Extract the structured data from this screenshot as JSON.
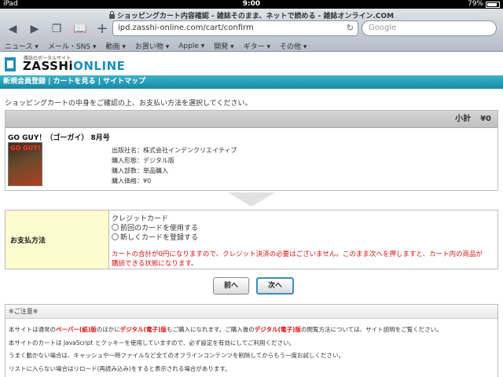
{
  "status": {
    "carrier": "iPad",
    "time": "9:00",
    "battery": "79%"
  },
  "browser": {
    "title": "ショッピングカート内容確認 - 雑誌そのまま、ネットで読める - 雑誌オンライン.COM",
    "url": "ipd.zasshi-online.com/cart/confirm",
    "search_placeholder": "Google",
    "bookmarks": [
      "ニュース ▾",
      "メール・SNS ▾",
      "動画 ▾",
      "お買い物 ▾",
      "Apple ▾",
      "開発 ▾",
      "ギター ▾",
      "その他 ▾"
    ],
    "icons": [
      "back-icon",
      "forward-icon",
      "tabs-icon",
      "bookmarks-icon",
      "add-icon",
      "reload-icon",
      "lock-icon"
    ]
  },
  "site": {
    "logo_sub": "雑誌のポータルサイト",
    "logo_prefix": "ZASSHi",
    "logo_accent": "ONLINE",
    "nav": "新規会員登録 | カートを見る | サイトマップ",
    "brand_color": "#1a8fb8"
  },
  "cart": {
    "intro": "ショッピングカートの中身をご確認の上、お支払い方法を選択してください。",
    "subtotal_label": "小計",
    "subtotal_value": "¥0",
    "item": {
      "title": "GO GUY！（ゴーガイ） 8月号",
      "cover_text": "GO GUY!",
      "details": [
        "出版社名：株式会社インデンクリエイティブ",
        "購入形態：デジタル版",
        "購入部数：単品購入",
        "購入価格：¥0"
      ]
    }
  },
  "payment": {
    "label": "お支払方法",
    "method": "クレジットカード",
    "option_previous": "前回のカードを使用する",
    "option_new": "新しくカードを登録する",
    "warning": "カートの合計が0円になりますので、クレジット決済の必要はございません。このまま次へを押しますと、カート内の商品が購読できる状態になります。"
  },
  "buttons": {
    "prev": "前へ",
    "next": "次へ"
  },
  "notes": {
    "heading": "※ご注意※",
    "line1_a": "本サイトは通常の",
    "line1_b": "ペーパー(紙)版",
    "line1_c": "のほかに",
    "line1_d": "デジタル(電子)版",
    "line1_e": "もご購入になれます。ご購入後の",
    "line1_f": "デジタル(電子)版",
    "line1_g": "の閲覧方法については、サイト説明をご覧ください。",
    "line2": "本サイトのカートは JavaScript とクッキーを使用していますので、必ず設定を有効にしてご利用ください。",
    "line3": "うまく動かない場合は、キャッシュや一時ファイルなど全てのオフラインコンテンツを削除してからもう一度お試しください。",
    "line4": "リストに入らない場合はリロード(再読み込み)をすると表示される場合があります。"
  }
}
